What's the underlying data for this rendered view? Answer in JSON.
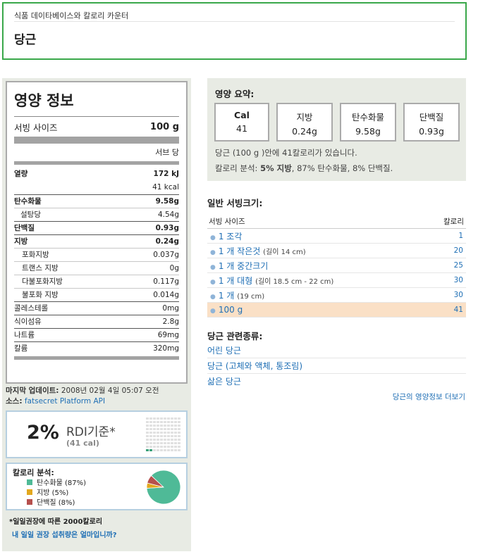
{
  "header": {
    "breadcrumb": "식품 데이타베이스와 칼로리 카운터",
    "title": "당근"
  },
  "nutrition": {
    "title": "영양 정보",
    "serving_label": "서빙 사이즈",
    "serving_value": "100 g",
    "per_label": "서브 당",
    "energy_label": "열량",
    "energy_kj": "172 kJ",
    "energy_kcal": "41 kcal",
    "rows": [
      {
        "label": "탄수화물",
        "value": "9.58g"
      },
      {
        "label": "설탕당",
        "value": "4.54g"
      },
      {
        "label": "단백질",
        "value": "0.93g"
      },
      {
        "label": "지방",
        "value": "0.24g"
      },
      {
        "label": "포화지방",
        "value": "0.037g"
      },
      {
        "label": "트랜스 지방",
        "value": "0g"
      },
      {
        "label": "다불포화지방",
        "value": "0.117g"
      },
      {
        "label": "불포화 지방",
        "value": "0.014g"
      },
      {
        "label": "콜레스테롤",
        "value": "0mg"
      },
      {
        "label": "식이섬유",
        "value": "2.8g"
      },
      {
        "label": "나트륨",
        "value": "69mg"
      },
      {
        "label": "칼륨",
        "value": "320mg"
      }
    ]
  },
  "update": {
    "label": "마지막 업데이트:",
    "value": "2008년 02월 4일 05:07 오전",
    "source_label": "소스:",
    "source_link": "fatsecret Platform API"
  },
  "rdi": {
    "percent": "2%",
    "label": "RDI기준*",
    "calories": "(41 cal)",
    "filled_cells": 2
  },
  "calorie_breakdown": {
    "title": "칼로리 분석:",
    "items": [
      {
        "label": "탄수화물 (87%)",
        "color": "#4fba97",
        "pct": 87
      },
      {
        "label": "지방 (5%)",
        "color": "#e3a81e",
        "pct": 5
      },
      {
        "label": "단백질 (8%)",
        "color": "#b6504d",
        "pct": 8
      }
    ]
  },
  "rdi_note": "*일일권장에 따른 2000칼로리",
  "rdi_link": "내 일일 권장 섭취량은 얼마입니까?",
  "summary": {
    "title": "영양 요약:",
    "boxes": [
      {
        "h": "Cal",
        "v": "41"
      },
      {
        "h": "지방",
        "v": "0.24g"
      },
      {
        "h": "탄수화물",
        "v": "9.58g"
      },
      {
        "h": "단백질",
        "v": "0.93g"
      }
    ],
    "line1_a": "당근 (100 g )안에 41칼로리가 있습니다.",
    "line2_a": "칼로리 분석: ",
    "line2_b": "5% 지방",
    "line2_c": ", 87% 탄수화물, 8% 단백질."
  },
  "servings": {
    "title": "일반 서빙크기:",
    "col_size": "서빙 사이즈",
    "col_cal": "칼로리",
    "rows": [
      {
        "label": "1 조각",
        "extra": "",
        "cal": "1"
      },
      {
        "label": "1 개 작은것",
        "extra": "(길이 14 cm)",
        "cal": "20"
      },
      {
        "label": "1 개 중간크기",
        "extra": "",
        "cal": "25"
      },
      {
        "label": "1 개 대형",
        "extra": "(길이 18.5 cm - 22 cm)",
        "cal": "30"
      },
      {
        "label": "1 개",
        "extra": "(19 cm)",
        "cal": "30"
      },
      {
        "label": "100 g",
        "extra": "",
        "cal": "41"
      }
    ]
  },
  "related": {
    "title": "당근 관련종류:",
    "items": [
      "어린 당근",
      "당근 (고체와 액체, 통조림)",
      "삶은 당근"
    ],
    "more": "당근의 영양정보 더보기"
  }
}
